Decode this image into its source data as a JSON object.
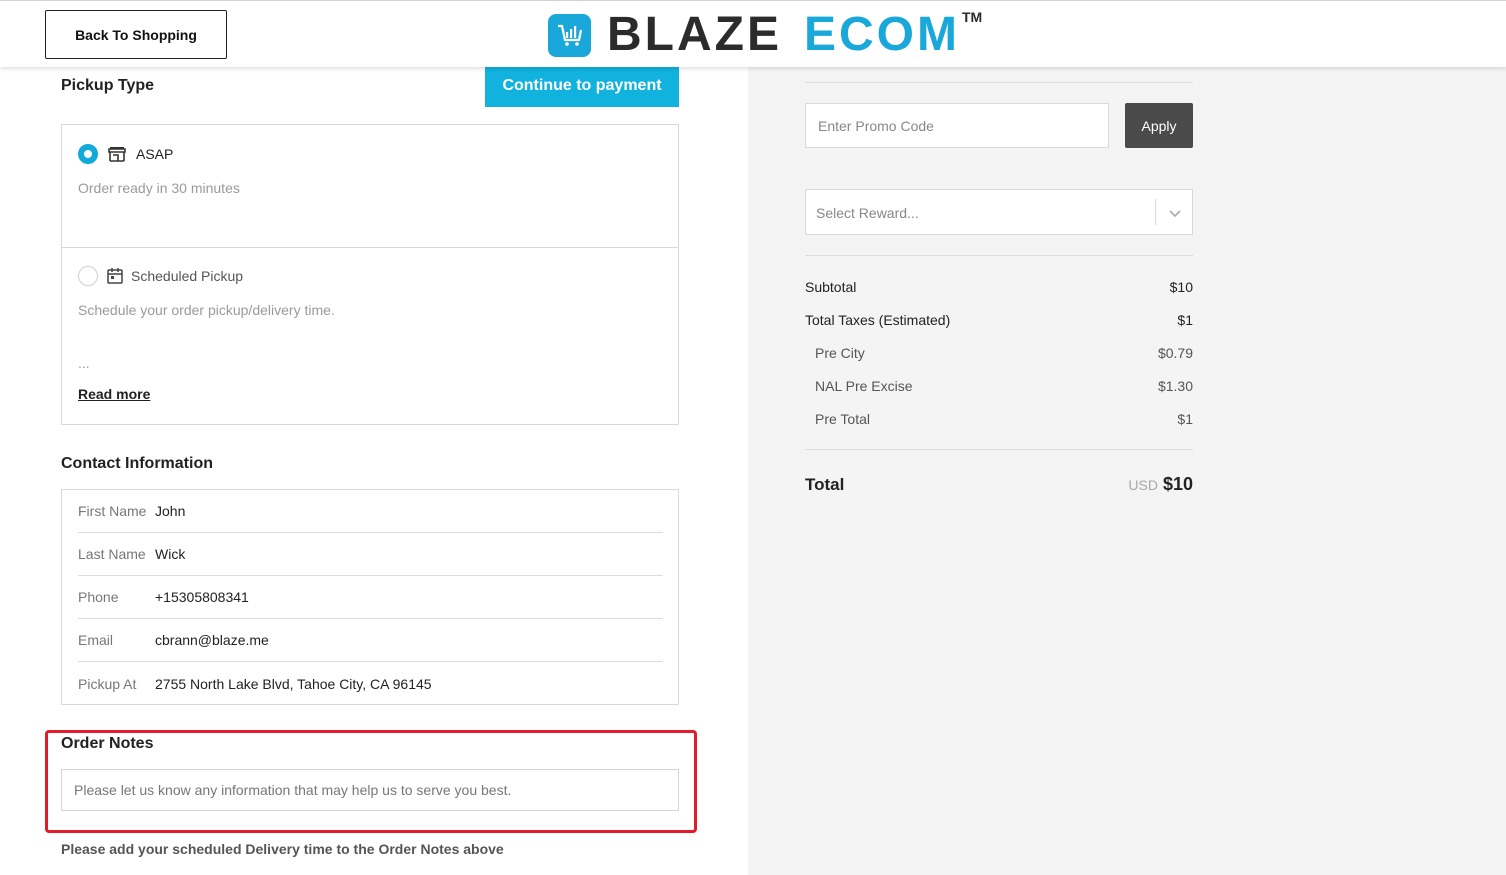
{
  "header": {
    "back_label": "Back To Shopping",
    "logo_part1": "BLAZE",
    "logo_part2": "ECOM",
    "logo_tm": "TM",
    "brand_color": "#1aa7d9"
  },
  "checkout": {
    "continue_label": "Continue to payment",
    "pickup": {
      "title": "Pickup Type",
      "options": [
        {
          "label": "ASAP",
          "description": "Order ready in 30 minutes",
          "selected": true,
          "icon": "store-icon"
        },
        {
          "label": "Scheduled Pickup",
          "description": "Schedule your order pickup/delivery time.",
          "ellipsis": "...",
          "selected": false,
          "icon": "calendar-icon"
        }
      ],
      "read_more": "Read more"
    },
    "contact": {
      "title": "Contact Information",
      "rows": [
        {
          "label": "First Name",
          "value": "John"
        },
        {
          "label": "Last Name",
          "value": "Wick"
        },
        {
          "label": "Phone",
          "value": "+15305808341"
        },
        {
          "label": "Email",
          "value": "cbrann@blaze.me"
        },
        {
          "label": "Pickup At",
          "value": "2755 North Lake Blvd, Tahoe City, CA 96145"
        }
      ]
    },
    "notes": {
      "title": "Order Notes",
      "placeholder": "Please let us know any information that may help us to serve you best.",
      "value": "",
      "delivery_note": "Please add your scheduled Delivery time to the Order Notes above"
    }
  },
  "summary": {
    "promo_placeholder": "Enter Promo Code",
    "apply_label": "Apply",
    "reward_placeholder": "Select Reward...",
    "lines": [
      {
        "label": "Subtotal",
        "value": "$10"
      },
      {
        "label": "Total Taxes (Estimated)",
        "value": "$1"
      }
    ],
    "tax_lines": [
      {
        "label": "Pre City",
        "value": "$0.79"
      },
      {
        "label": "NAL Pre Excise",
        "value": "$1.30"
      },
      {
        "label": "Pre Total",
        "value": "$1"
      }
    ],
    "total_label": "Total",
    "total_currency": "USD",
    "total_value": "$10"
  }
}
